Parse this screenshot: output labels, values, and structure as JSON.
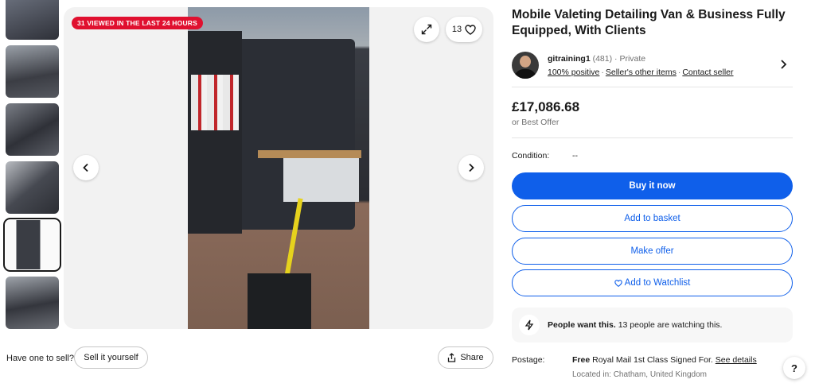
{
  "gallery": {
    "viewed_badge": "31 VIEWED IN THE LAST 24 HOURS",
    "watch_count": "13",
    "thumbnails": [
      {
        "selected": false
      },
      {
        "selected": false
      },
      {
        "selected": false
      },
      {
        "selected": false
      },
      {
        "selected": true
      },
      {
        "selected": false
      }
    ]
  },
  "below_gallery": {
    "sell_prompt": "Have one to sell?",
    "sell_button": "Sell it yourself",
    "share_button": "Share"
  },
  "listing": {
    "title": "Mobile Valeting Detailing Van & Business Fully Equipped, With Clients"
  },
  "seller": {
    "name": "gitraining1",
    "feedback_count": "(481)",
    "type": "· Private",
    "positive": "100% positive",
    "other_items": "Seller's other items",
    "contact": "Contact seller"
  },
  "price": {
    "amount": "£17,086.68",
    "best_offer": "or Best Offer"
  },
  "condition": {
    "label": "Condition:",
    "value": "--"
  },
  "actions": {
    "buy_now": "Buy it now",
    "add_to_basket": "Add to basket",
    "make_offer": "Make offer",
    "add_to_watchlist": "Add to Watchlist"
  },
  "watchers": {
    "headline": "People want this.",
    "detail": "13 people are watching this."
  },
  "postage": {
    "label": "Postage:",
    "free": "Free",
    "service": "Royal Mail 1st Class Signed For.",
    "details_link": "See details",
    "location": "Located in: Chatham, United Kingdom"
  },
  "help_button": "?",
  "colors": {
    "primary": "#0f5fea",
    "badge": "#e0102f"
  }
}
